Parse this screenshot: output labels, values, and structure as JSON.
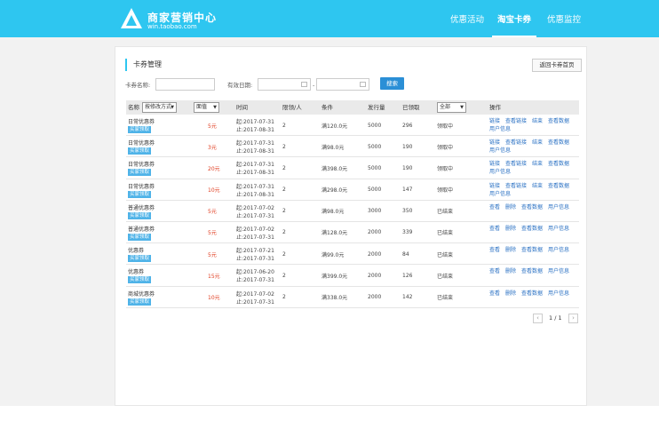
{
  "header": {
    "brand_name": "商家营销中心",
    "brand_sub": "win.taobao.com",
    "nav": [
      "优惠活动",
      "淘宝卡券",
      "优惠监控"
    ],
    "active_nav": 1
  },
  "panel": {
    "title": "卡券管理",
    "back_button": "返回卡券首页",
    "filters": {
      "name_label": "卡券名称:",
      "date_label": "有效日期:",
      "date_sep": "-",
      "search_button": "搜索"
    }
  },
  "table": {
    "headers": {
      "name": "名称",
      "type_select": "按修改方式",
      "value_select": "面值",
      "time": "时间",
      "limit": "限领/人",
      "condition": "条件",
      "issued": "发行量",
      "claimed": "已领取",
      "status_select": "全部",
      "ops": "操作"
    },
    "rows": [
      {
        "name": "日常优惠券",
        "tag": "买家领取",
        "value": "5元",
        "start": "起:2017-07-31",
        "end": "止:2017-08-31",
        "limit": "2",
        "cond": "满120.0元",
        "issued": "5000",
        "claimed": "296",
        "status": "领取中",
        "ops": [
          "链接",
          "查看链接",
          "结束",
          "查看数据",
          "用户信息"
        ]
      },
      {
        "name": "日常优惠券",
        "tag": "买家领取",
        "value": "3元",
        "start": "起:2017-07-31",
        "end": "止:2017-08-31",
        "limit": "2",
        "cond": "满98.0元",
        "issued": "5000",
        "claimed": "190",
        "status": "领取中",
        "ops": [
          "链接",
          "查看链接",
          "结束",
          "查看数据",
          "用户信息"
        ]
      },
      {
        "name": "日常优惠券",
        "tag": "买家领取",
        "value": "20元",
        "start": "起:2017-07-31",
        "end": "止:2017-08-31",
        "limit": "2",
        "cond": "满398.0元",
        "issued": "5000",
        "claimed": "190",
        "status": "领取中",
        "ops": [
          "链接",
          "查看链接",
          "结束",
          "查看数据",
          "用户信息"
        ]
      },
      {
        "name": "日常优惠券",
        "tag": "买家领取",
        "value": "10元",
        "start": "起:2017-07-31",
        "end": "止:2017-08-31",
        "limit": "2",
        "cond": "满298.0元",
        "issued": "5000",
        "claimed": "147",
        "status": "领取中",
        "ops": [
          "链接",
          "查看链接",
          "结束",
          "查看数据",
          "用户信息"
        ]
      },
      {
        "name": "普通优惠券",
        "tag": "买家领取",
        "value": "5元",
        "start": "起:2017-07-02",
        "end": "止:2017-07-31",
        "limit": "2",
        "cond": "满98.0元",
        "issued": "3000",
        "claimed": "350",
        "status": "已结束",
        "ops": [
          "查看",
          "删除",
          "查看数据",
          "用户信息"
        ]
      },
      {
        "name": "普通优惠券",
        "tag": "买家领取",
        "value": "5元",
        "start": "起:2017-07-02",
        "end": "止:2017-07-31",
        "limit": "2",
        "cond": "满128.0元",
        "issued": "2000",
        "claimed": "339",
        "status": "已结束",
        "ops": [
          "查看",
          "删除",
          "查看数据",
          "用户信息"
        ]
      },
      {
        "name": "优惠券",
        "tag": "买家领取",
        "value": "5元",
        "start": "起:2017-07-21",
        "end": "止:2017-07-31",
        "limit": "2",
        "cond": "满99.0元",
        "issued": "2000",
        "claimed": "84",
        "status": "已结束",
        "ops": [
          "查看",
          "删除",
          "查看数据",
          "用户信息"
        ]
      },
      {
        "name": "优惠券",
        "tag": "买家领取",
        "value": "15元",
        "start": "起:2017-06-20",
        "end": "止:2017-07-31",
        "limit": "2",
        "cond": "满399.0元",
        "issued": "2000",
        "claimed": "126",
        "status": "已结束",
        "ops": [
          "查看",
          "删除",
          "查看数据",
          "用户信息"
        ]
      },
      {
        "name": "商城优惠券",
        "tag": "买家领取",
        "value": "10元",
        "start": "起:2017-07-02",
        "end": "止:2017-07-31",
        "limit": "2",
        "cond": "满338.0元",
        "issued": "2000",
        "claimed": "142",
        "status": "已结束",
        "ops": [
          "查看",
          "删除",
          "查看数据",
          "用户信息"
        ]
      }
    ]
  },
  "pager": {
    "text": "1 / 1",
    "prev": "‹",
    "next": "›"
  }
}
